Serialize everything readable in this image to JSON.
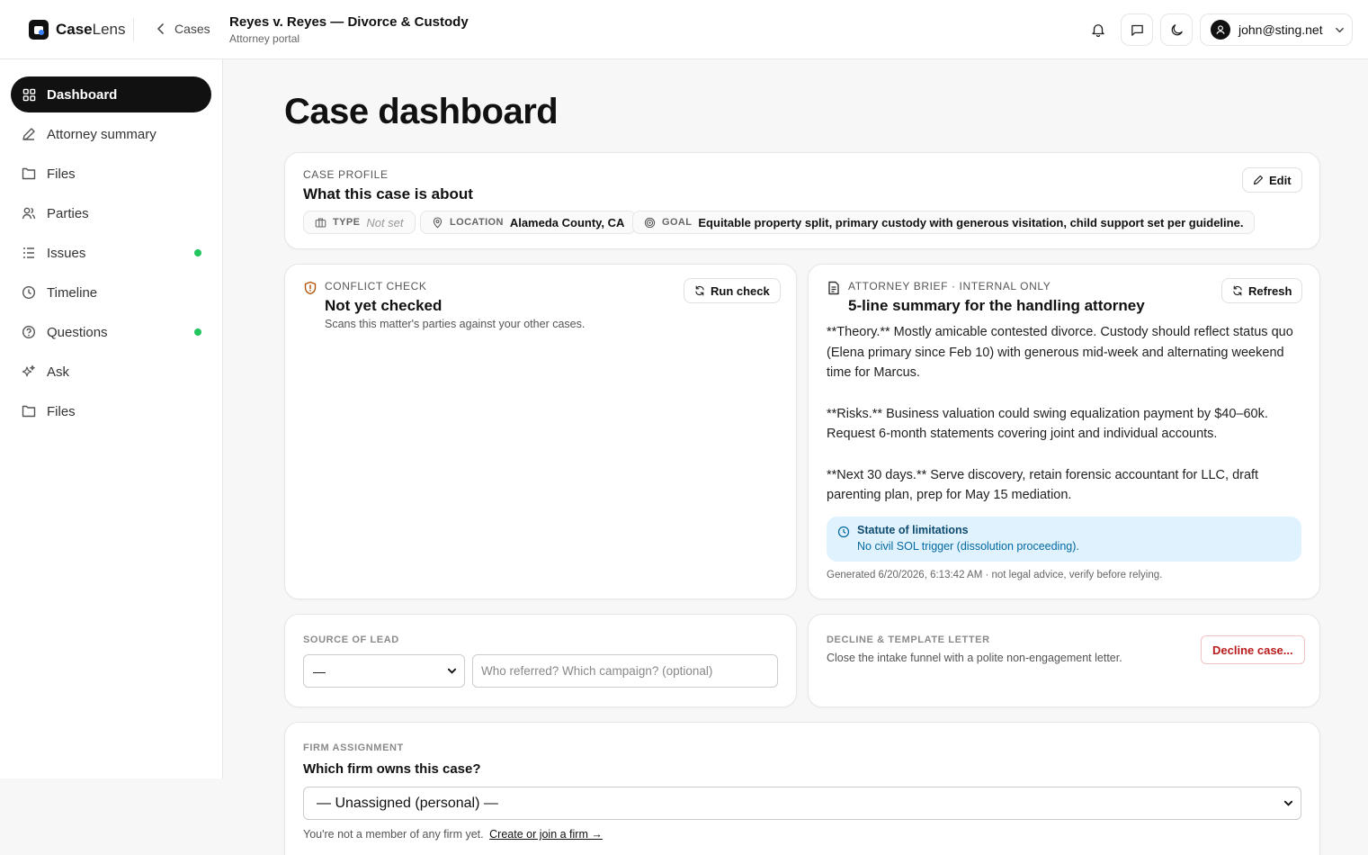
{
  "app": {
    "brand_bold": "Case",
    "brand_light": "Lens"
  },
  "header": {
    "back_label": "Cases",
    "case_title": "Reyes v. Reyes — Divorce & Custody",
    "case_subtitle": "Attorney portal",
    "user_email": "john@sting.net"
  },
  "sidebar": {
    "items": [
      {
        "label": "Dashboard",
        "icon": "dashboard-icon",
        "active": true,
        "dot": false
      },
      {
        "label": "Attorney summary",
        "icon": "pen-icon",
        "active": false,
        "dot": false
      },
      {
        "label": "Files",
        "icon": "folder-icon",
        "active": false,
        "dot": false
      },
      {
        "label": "Parties",
        "icon": "users-icon",
        "active": false,
        "dot": false
      },
      {
        "label": "Issues",
        "icon": "list-icon",
        "active": false,
        "dot": true
      },
      {
        "label": "Timeline",
        "icon": "clock-icon",
        "active": false,
        "dot": false
      },
      {
        "label": "Questions",
        "icon": "help-circle-icon",
        "active": false,
        "dot": true
      },
      {
        "label": "Ask",
        "icon": "sparkles-icon",
        "active": false,
        "dot": false
      },
      {
        "label": "Files",
        "icon": "folder-icon",
        "active": false,
        "dot": false
      }
    ],
    "dot_color": "#22c55e"
  },
  "main": {
    "page_title": "Case dashboard",
    "case_profile": {
      "eyebrow": "Case profile",
      "heading": "What this case is about",
      "edit_label": "Edit",
      "type_key": "TYPE",
      "type_value": "Not set",
      "location_key": "LOCATION",
      "location_value": "Alameda County, CA",
      "goal_key": "GOAL",
      "goal_value": "Equitable property split, primary custody with generous visitation, child support set per guideline."
    },
    "conflict_check": {
      "eyebrow": "Conflict check",
      "heading": "Not yet checked",
      "description": "Scans this matter's parties against your other cases.",
      "button_label": "Run check"
    },
    "attorney_brief": {
      "eyebrow": "Attorney brief · Internal only",
      "heading": "5-line summary for the handling attorney",
      "button_label": "Refresh",
      "paragraphs": [
        "**Theory.** Mostly amicable contested divorce. Custody should reflect status quo (Elena primary since Feb 10) with generous mid-week and alternating weekend time for Marcus.",
        "**Risks.** Business valuation could swing equalization payment by $40–60k. Request 6-month statements covering joint and individual accounts.",
        "**Next 30 days.** Serve discovery, retain forensic accountant for LLC, draft parenting plan, prep for May 15 mediation."
      ],
      "sol_title": "Statute of limitations",
      "sol_text": "No civil SOL trigger (dissolution proceeding).",
      "generated_text": "Generated 6/20/2026, 6:13:42 AM · not legal advice, verify before relying."
    },
    "source_of_lead": {
      "eyebrow": "Source of lead",
      "select_value": "—",
      "input_placeholder": "Who referred? Which campaign? (optional)"
    },
    "decline": {
      "eyebrow": "Decline & template letter",
      "description": "Close the intake funnel with a polite non-engagement letter.",
      "button_label": "Decline case..."
    },
    "firm_assignment": {
      "eyebrow": "Firm assignment",
      "heading": "Which firm owns this case?",
      "select_value": "— Unassigned (personal) —",
      "note_prefix": "You're not a member of any firm yet.",
      "note_link": "Create or join a firm →"
    }
  },
  "colors": {
    "accent": "#111111",
    "info_bg": "#e0f2fe",
    "info_text": "#0369a1",
    "danger": "#b91c1c",
    "warning_icon": "#b45309"
  }
}
